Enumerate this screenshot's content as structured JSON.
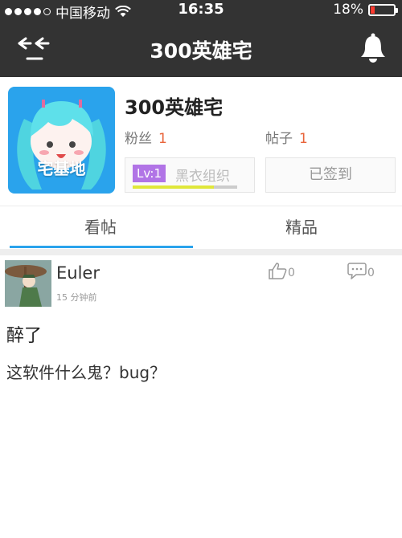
{
  "status_bar": {
    "signal_dots_filled": 4,
    "carrier": "中国移动",
    "time": "16:35",
    "battery_percent": "18%",
    "battery_level": 0.18,
    "battery_color": "#ff3b30"
  },
  "nav": {
    "title": "300英雄宅",
    "back_icon": "back-arrows-icon",
    "bell_icon": "bell-icon"
  },
  "forum": {
    "name": "300英雄宅",
    "avatar_label": "宅基地",
    "fans_label": "粉丝",
    "fans_count": "1",
    "posts_label": "帖子",
    "posts_count": "1",
    "level_badge": "Lv:1",
    "level_name": "黑衣组织",
    "level_progress": 0.78,
    "signed_label": "已签到"
  },
  "tabs": [
    {
      "label": "看帖",
      "active": true
    },
    {
      "label": "精品",
      "active": false
    }
  ],
  "post": {
    "username": "Euler",
    "time": "15 分钟前",
    "likes": "0",
    "comments": "0",
    "title": "醉了",
    "body": "这软件什么鬼？bug？"
  },
  "colors": {
    "header_bg": "#333333",
    "accent_blue": "#2aa3ec",
    "count_orange": "#e8643a",
    "level_purple": "#b174e6",
    "level_bar": "#e0e73a"
  }
}
